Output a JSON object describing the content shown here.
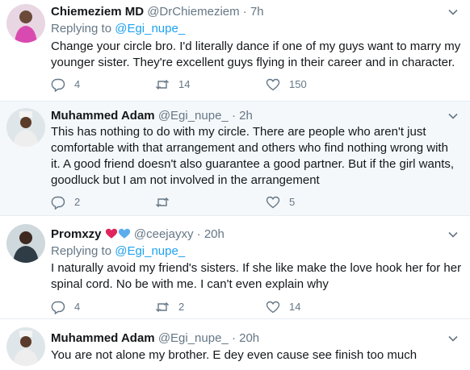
{
  "tweets": [
    {
      "name": "Chiemeziem MD",
      "handle": "@DrChiemeziem",
      "separator": "·",
      "time": "7h",
      "replying_prefix": "Replying to",
      "replying_to": "@Egi_nupe_",
      "lines": [
        "Change your circle bro. I'd literally dance if one of my guys want to marry my",
        "younger sister. They're excellent guys flying in their career and in character."
      ],
      "replies": "4",
      "retweets": "14",
      "likes": "150"
    },
    {
      "name": "Muhammed Adam",
      "handle": "@Egi_nupe_",
      "separator": "·",
      "time": "2h",
      "lines": [
        "This has nothing to do with my circle. There are people who aren't just",
        "comfortable with that arrangement and others who find nothing wrong with",
        "it. A good friend doesn't also guarantee a good partner. But if the girl wants,",
        "goodluck but I am not involved in the arrangement"
      ],
      "replies": "2",
      "retweets": "",
      "likes": "5"
    },
    {
      "name": "Promxzy",
      "handle": "@ceejayxy",
      "separator": "·",
      "time": "20h",
      "replying_prefix": "Replying to",
      "replying_to": "@Egi_nupe_",
      "lines": [
        "I naturally avoid my friend's sisters. If she like make the love hook her for her",
        "spinal cord. No be with me. I can't even explain why"
      ],
      "replies": "4",
      "retweets": "2",
      "likes": "14"
    },
    {
      "name": "Muhammed Adam",
      "handle": "@Egi_nupe_",
      "separator": "·",
      "time": "20h",
      "lines": [
        "You are not alone my brother. E dey even cause see finish too much"
      ]
    }
  ],
  "colors": {
    "accent": "#1da1f2",
    "muted": "#657786",
    "text": "#14171a",
    "border": "#e6ecf0",
    "shaded_bg": "#f5f8fa",
    "heart_red": "#e0245e",
    "heart_blue": "#5dadec"
  },
  "icons": [
    "chevron-down-icon",
    "reply-icon",
    "retweet-icon",
    "like-icon",
    "red-heart-emoji",
    "blue-heart-emoji"
  ]
}
